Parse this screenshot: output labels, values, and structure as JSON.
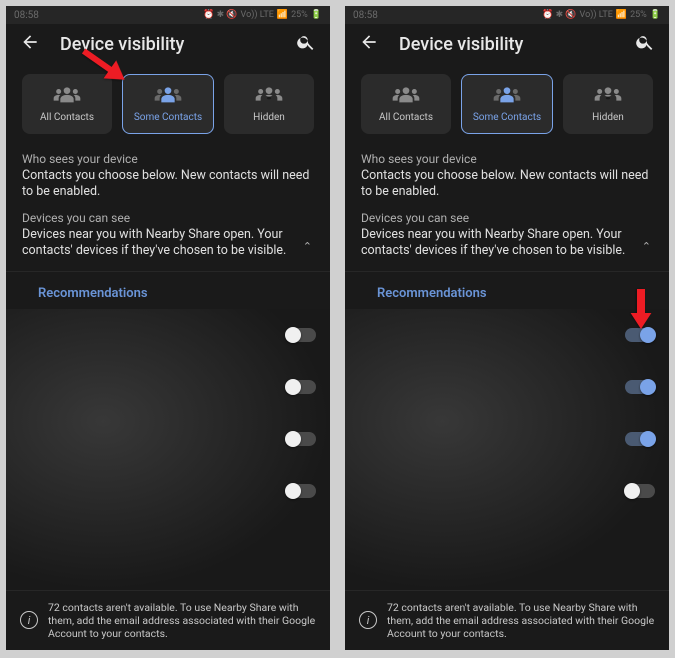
{
  "status": {
    "time": "08:58",
    "battery": "25%",
    "net": "Vo)) LTE",
    "signal": "📶"
  },
  "header": {
    "title": "Device visibility"
  },
  "tabs": {
    "all": "All Contacts",
    "some": "Some Contacts",
    "hidden": "Hidden"
  },
  "who_sees": {
    "title": "Who sees your device",
    "desc": "Contacts you choose below. New contacts will need to be enabled."
  },
  "you_see": {
    "title": "Devices you can see",
    "desc": "Devices near you with Nearby Share open. Your contacts' devices if they've chosen to be visible."
  },
  "reco": {
    "label": "Recommendations"
  },
  "footer": {
    "text": "72 contacts aren't available. To use Nearby Share with them, add the email address associated with their Google Account to your contacts."
  },
  "left": {
    "toggles": [
      {
        "on": false
      },
      {
        "on": false
      },
      {
        "on": false
      },
      {
        "on": false
      }
    ]
  },
  "right": {
    "toggles": [
      {
        "on": true
      },
      {
        "on": true
      },
      {
        "on": true
      },
      {
        "on": false
      }
    ]
  }
}
